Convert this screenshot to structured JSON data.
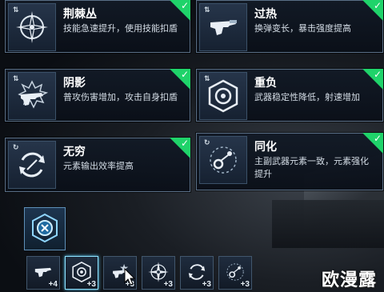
{
  "cards": [
    {
      "name": "card-thorn-bush",
      "title": "荆棘丛",
      "desc": "技能急速提升，使用技能扣盾",
      "lvl": "⇅",
      "icon": "compass-star-icon"
    },
    {
      "name": "card-overheat",
      "title": "过热",
      "desc": "换弹变长，暴击强度提高",
      "lvl": "⇅",
      "icon": "pistol-icon"
    },
    {
      "name": "card-shadow",
      "title": "阴影",
      "desc": "普攻伤害增加，攻击自身扣盾",
      "lvl": "⇅",
      "icon": "spiky-pistol-icon"
    },
    {
      "name": "card-burden",
      "title": "重负",
      "desc": "武器稳定性降低，射速增加",
      "lvl": "⇅",
      "icon": "hexagon-target-icon"
    },
    {
      "name": "card-endless",
      "title": "无穷",
      "desc": "元素输出效率提高",
      "lvl": "↻",
      "icon": "cycle-arrows-icon"
    },
    {
      "name": "card-assimilate",
      "title": "同化",
      "desc": "主副武器元素一致，元素强化提升",
      "lvl": "↻",
      "icon": "linked-orbs-icon"
    }
  ],
  "check_mark": "✓",
  "slots": [
    {
      "count": "+4",
      "icon": "pistol-icon"
    },
    {
      "count": "+3",
      "icon": "hexagon-target-icon"
    },
    {
      "count": "+3",
      "icon": "spiky-pistol-icon"
    },
    {
      "count": "+3",
      "icon": "compass-star-icon"
    },
    {
      "count": "+3",
      "icon": "cycle-arrows-icon"
    },
    {
      "count": "+3",
      "icon": "linked-orbs-icon"
    }
  ],
  "watermark": "欧漫露"
}
